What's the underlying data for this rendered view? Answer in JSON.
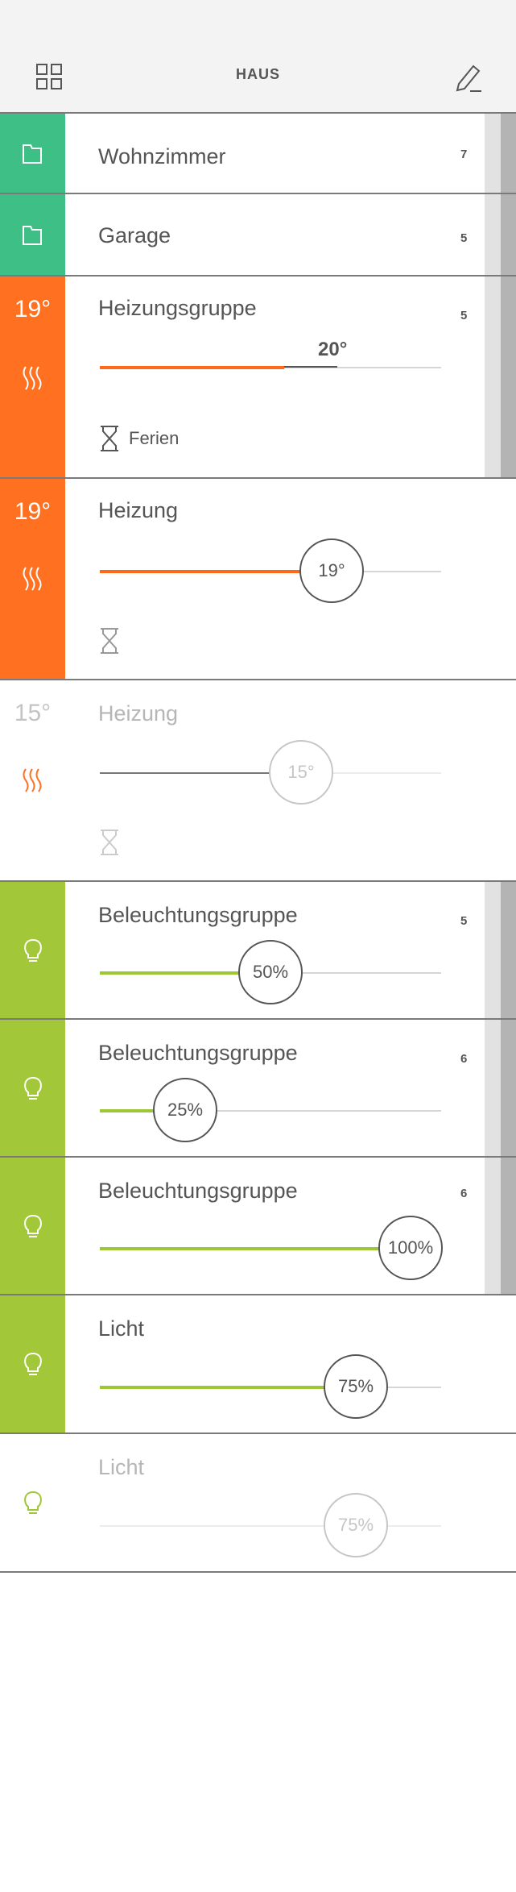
{
  "header": {
    "title": "HAUS",
    "grid_icon": "grid-icon",
    "edit_icon": "pencil-icon"
  },
  "colors": {
    "green": "#3ebf85",
    "orange": "#ff7020",
    "lime": "#a2c83a"
  },
  "rows": [
    {
      "label": "Wohnzimmer",
      "count": "7",
      "icon": "folder-icon"
    },
    {
      "label": "Garage",
      "count": "5",
      "icon": "folder-icon"
    },
    {
      "label": "Heizungsgruppe",
      "count": "5",
      "temp": "19°",
      "target": "20°",
      "target_percent": 54,
      "mode": "Ferien",
      "icon": "heating-icon"
    },
    {
      "label": "Heizung",
      "temp": "19°",
      "value": "19°",
      "percent": 68,
      "icon": "heating-icon"
    },
    {
      "label": "Heizung",
      "temp": "15°",
      "value": "15°",
      "percent": 59,
      "icon": "heating-icon"
    },
    {
      "label": "Beleuchtungsgruppe",
      "count": "5",
      "value": "50%",
      "percent": 50,
      "icon": "bulb-icon"
    },
    {
      "label": "Beleuchtungsgruppe",
      "count": "6",
      "value": "25%",
      "percent": 25,
      "icon": "bulb-icon"
    },
    {
      "label": "Beleuchtungsgruppe",
      "count": "6",
      "value": "100%",
      "percent": 100,
      "icon": "bulb-icon"
    },
    {
      "label": "Licht",
      "value": "75%",
      "percent": 75,
      "icon": "bulb-icon"
    },
    {
      "label": "Licht",
      "value": "75%",
      "percent": 75,
      "icon": "bulb-icon"
    }
  ]
}
